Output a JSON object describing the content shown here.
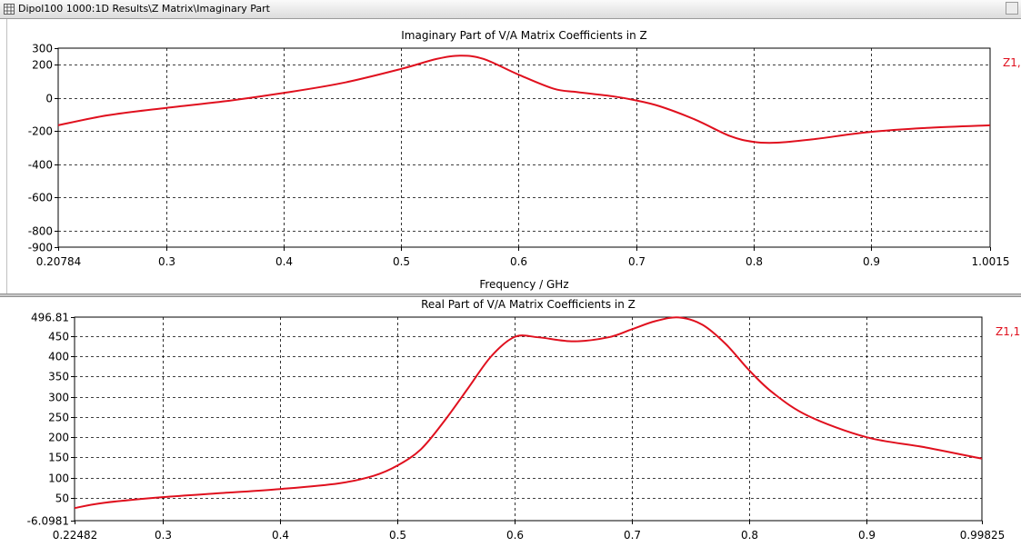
{
  "window": {
    "title": "Dipol100 1000:1D Results\\Z Matrix\\Imaginary Part",
    "icon": "grid-icon"
  },
  "colors": {
    "curve": "#e0101e",
    "grid": "#000000",
    "axis": "#000000",
    "text": "#000000"
  },
  "chart_data": [
    {
      "type": "line",
      "title": "Imaginary Part of V/A Matrix Coefficients in Z",
      "xlabel": "Frequency / GHz",
      "ylabel": "",
      "xlim": [
        0.20784,
        1.0015
      ],
      "ylim": [
        -900,
        300
      ],
      "x_ticks": [
        0.20784,
        0.3,
        0.4,
        0.5,
        0.6,
        0.7,
        0.8,
        0.9,
        1.0015
      ],
      "x_tick_labels": [
        "0.20784",
        "0.3",
        "0.4",
        "0.5",
        "0.6",
        "0.7",
        "0.8",
        "0.9",
        "1.0015"
      ],
      "y_ticks": [
        300,
        200,
        0,
        -200,
        -400,
        -600,
        -800,
        -900
      ],
      "y_tick_labels": [
        "300",
        "200",
        "0",
        "-200",
        "-400",
        "-600",
        "-800",
        "-900"
      ],
      "grid": true,
      "legend_position": "top-right",
      "series": [
        {
          "name": "Z1,",
          "x": [
            0.20784,
            0.25,
            0.3,
            0.35,
            0.4,
            0.45,
            0.5,
            0.53,
            0.55,
            0.57,
            0.6,
            0.63,
            0.65,
            0.68,
            0.7,
            0.72,
            0.75,
            0.78,
            0.8,
            0.82,
            0.85,
            0.9,
            0.95,
            1.0015
          ],
          "y": [
            -165,
            -105,
            -60,
            -20,
            30,
            90,
            175,
            235,
            255,
            235,
            140,
            55,
            35,
            10,
            -15,
            -50,
            -130,
            -230,
            -265,
            -270,
            -250,
            -205,
            -180,
            -165
          ]
        }
      ]
    },
    {
      "type": "line",
      "title": "Real Part of V/A Matrix Coefficients in Z",
      "xlabel": "",
      "ylabel": "",
      "xlim": [
        0.22482,
        0.99825
      ],
      "ylim": [
        -6.0981,
        496.81
      ],
      "x_ticks": [
        0.22482,
        0.3,
        0.4,
        0.5,
        0.6,
        0.7,
        0.8,
        0.9,
        0.99825
      ],
      "x_tick_labels": [
        "0.22482",
        "0.3",
        "0.4",
        "0.5",
        "0.6",
        "0.7",
        "0.8",
        "0.9",
        "0.99825"
      ],
      "y_ticks": [
        496.81,
        450,
        400,
        350,
        300,
        250,
        200,
        150,
        100,
        50,
        -6.0981
      ],
      "y_tick_labels": [
        "496.81",
        "450",
        "400",
        "350",
        "300",
        "250",
        "200",
        "150",
        "100",
        "50",
        "-6.0981"
      ],
      "grid": true,
      "legend_position": "top-right",
      "series": [
        {
          "name": "Z1,1",
          "x": [
            0.22482,
            0.25,
            0.3,
            0.35,
            0.4,
            0.45,
            0.48,
            0.5,
            0.52,
            0.54,
            0.56,
            0.58,
            0.6,
            0.62,
            0.65,
            0.68,
            0.7,
            0.72,
            0.74,
            0.76,
            0.78,
            0.8,
            0.82,
            0.85,
            0.9,
            0.95,
            0.99825
          ],
          "y": [
            25,
            38,
            52,
            62,
            72,
            86,
            105,
            130,
            170,
            240,
            320,
            400,
            448,
            447,
            437,
            447,
            467,
            487,
            496,
            478,
            430,
            365,
            310,
            253,
            200,
            175,
            147
          ]
        }
      ]
    }
  ]
}
